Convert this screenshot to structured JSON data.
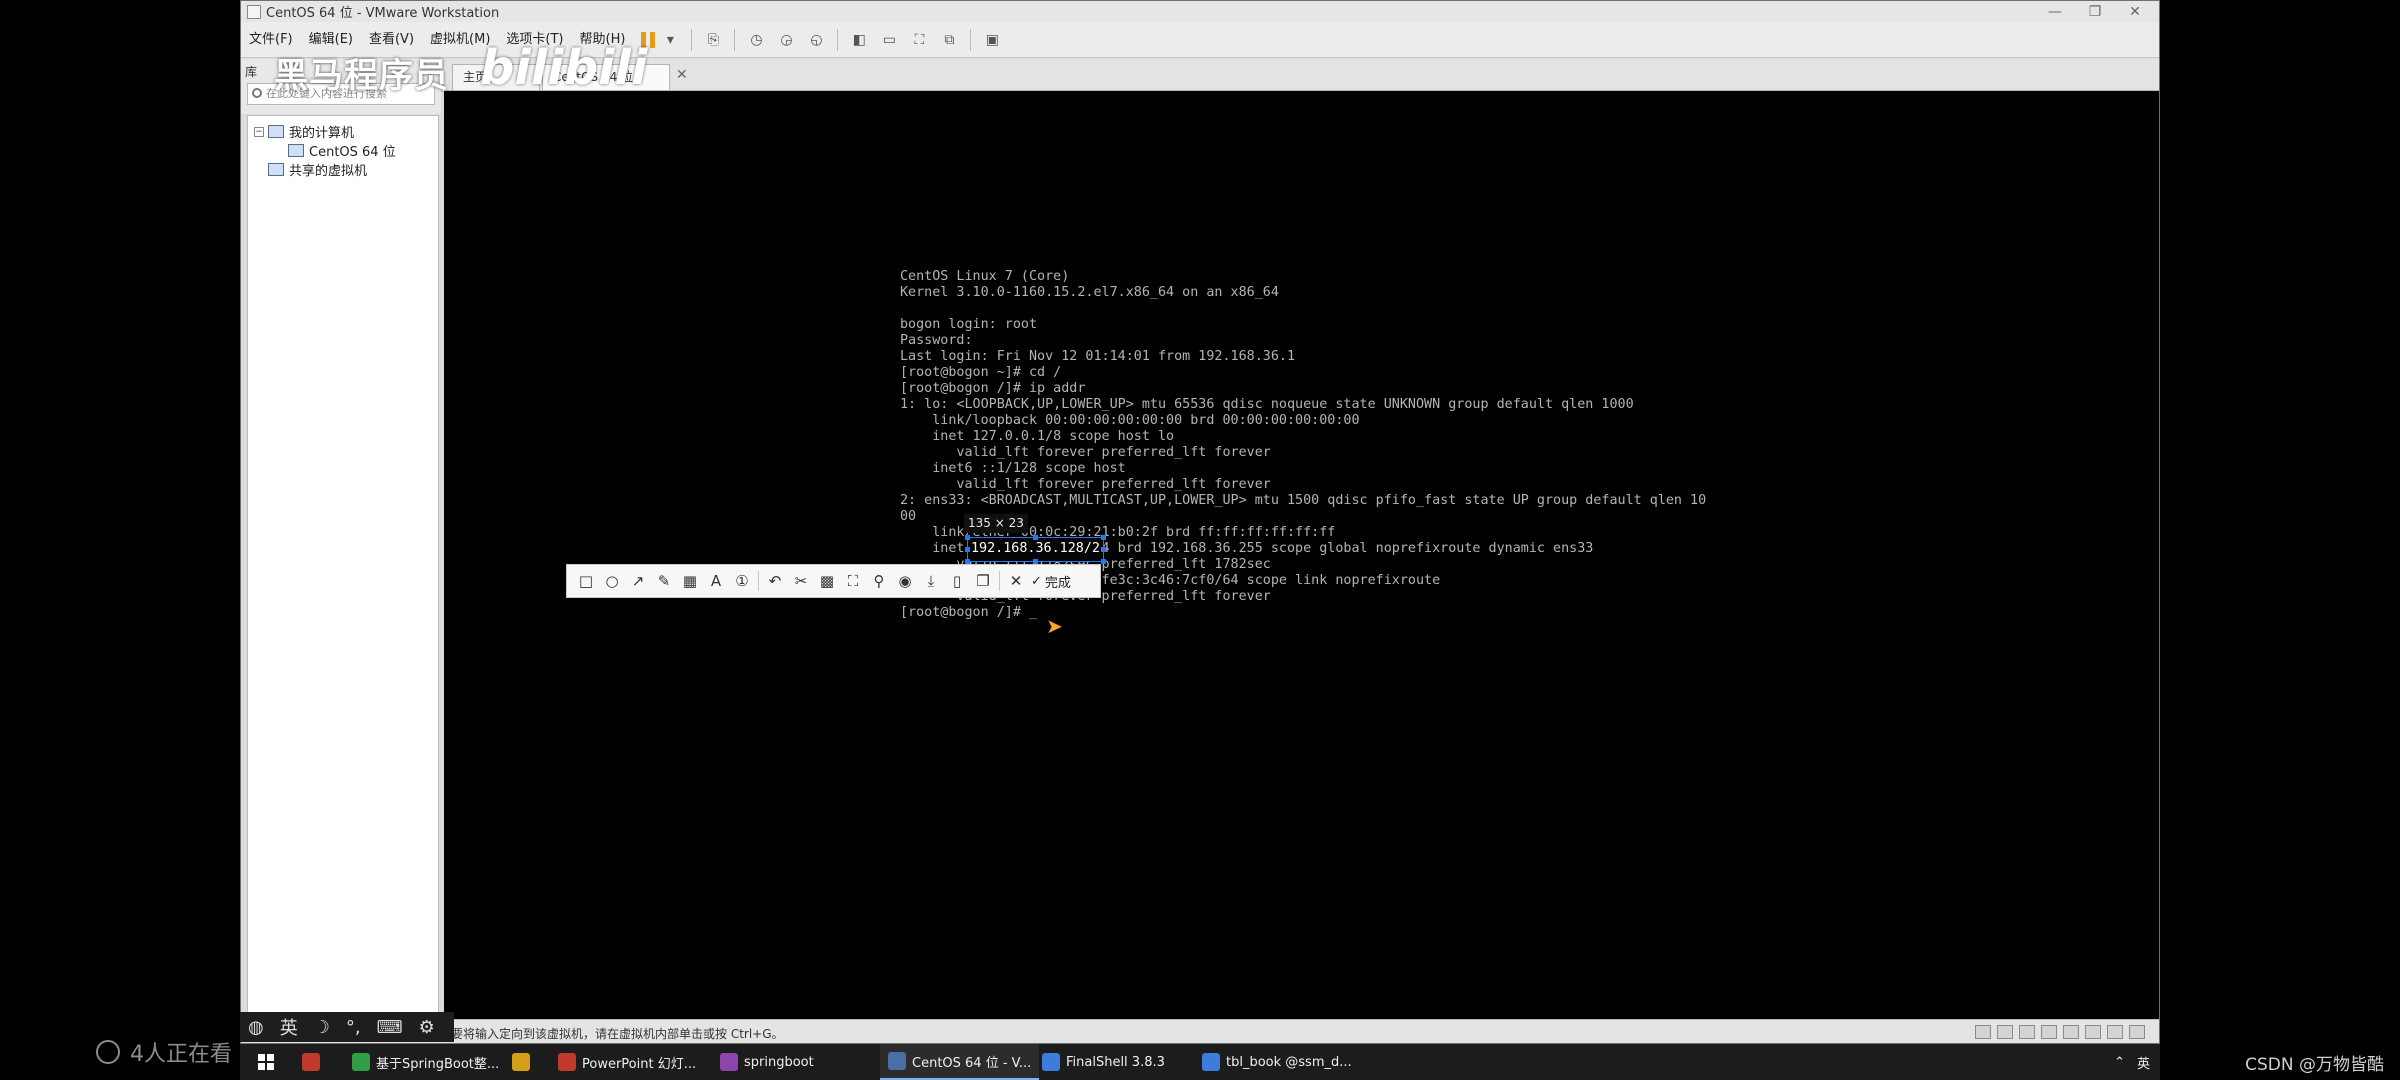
{
  "window": {
    "title": "CentOS 64 位 - VMware Workstation",
    "controls": [
      "—",
      "❐",
      "✕"
    ]
  },
  "menu": {
    "items": [
      "文件(F)",
      "编辑(E)",
      "查看(V)",
      "虚拟机(M)",
      "选项卡(T)",
      "帮助(H)"
    ]
  },
  "library": {
    "title": "库",
    "search_placeholder": "在此处键入内容进行搜索",
    "tree": {
      "my_computer": "我的计算机",
      "vm": "CentOS 64 位",
      "shared": "共享的虚拟机"
    }
  },
  "tabs": {
    "home": "主页",
    "vm": "CentOS 64 位"
  },
  "terminal": {
    "lines": [
      "CentOS Linux 7 (Core)",
      "Kernel 3.10.0-1160.15.2.el7.x86_64 on an x86_64",
      "",
      "bogon login: root",
      "Password:",
      "Last login: Fri Nov 12 01:14:01 from 192.168.36.1",
      "[root@bogon ~]# cd /",
      "[root@bogon /]# ip addr",
      "1: lo: <LOOPBACK,UP,LOWER_UP> mtu 65536 qdisc noqueue state UNKNOWN group default qlen 1000",
      "    link/loopback 00:00:00:00:00:00 brd 00:00:00:00:00:00",
      "    inet 127.0.0.1/8 scope host lo",
      "       valid_lft forever preferred_lft forever",
      "    inet6 ::1/128 scope host",
      "       valid_lft forever preferred_lft forever",
      "2: ens33: <BROADCAST,MULTICAST,UP,LOWER_UP> mtu 1500 qdisc pfifo_fast state UP group default qlen 10",
      "00",
      "    link/ether 00:0c:29:21:b0:2f brd ff:ff:ff:ff:ff:ff",
      "    inet 192.168.36.128/24 brd 192.168.36.255 scope global noprefixroute dynamic ens33",
      "       valid_lft 1782sec preferred_lft 1782sec",
      "    inet6 fe80::20c:29ff:fe3c:3c46:7cf0/64 scope link noprefixroute",
      "       valid_lft forever preferred_lft forever",
      "[root@bogon /]# _"
    ]
  },
  "capture": {
    "size_label": "135 × 23",
    "selected_text": "192.168.36.128/2",
    "tools": [
      "□",
      "○",
      "↗",
      "✎",
      "▦",
      "A",
      "①",
      "↶",
      "✂",
      "▩",
      "⛶",
      "⚲",
      "◉",
      "⤓",
      "▯",
      "❐",
      "✕"
    ],
    "done_label": "完成"
  },
  "status": {
    "text": "要将输入定向到该虚拟机，请在虚拟机内部单击或按 Ctrl+G。"
  },
  "watermark": {
    "brand": "黑马程序员",
    "bili": "bilibili",
    "viewers": "4人正在看",
    "csdn": "CSDN @万物皆酷"
  },
  "ime": {
    "items": [
      "英",
      "☽",
      "°,",
      "⌨",
      "⚙"
    ]
  },
  "taskbar": {
    "items": [
      {
        "label": "",
        "color": "#c0392b"
      },
      {
        "label": "基于SpringBoot整...",
        "color": "#2f9e44"
      },
      {
        "label": "",
        "color": "#d4a017"
      },
      {
        "label": "PowerPoint 幻灯...",
        "color": "#c0392b"
      },
      {
        "label": "springboot",
        "color": "#8e44ad"
      },
      {
        "label": "CentOS 64 位 - V...",
        "color": "#4a6fa5"
      },
      {
        "label": "FinalShell 3.8.3",
        "color": "#3b7dd8"
      },
      {
        "label": "tbl_book @ssm_d...",
        "color": "#3b7dd8"
      }
    ],
    "tray": "英"
  }
}
